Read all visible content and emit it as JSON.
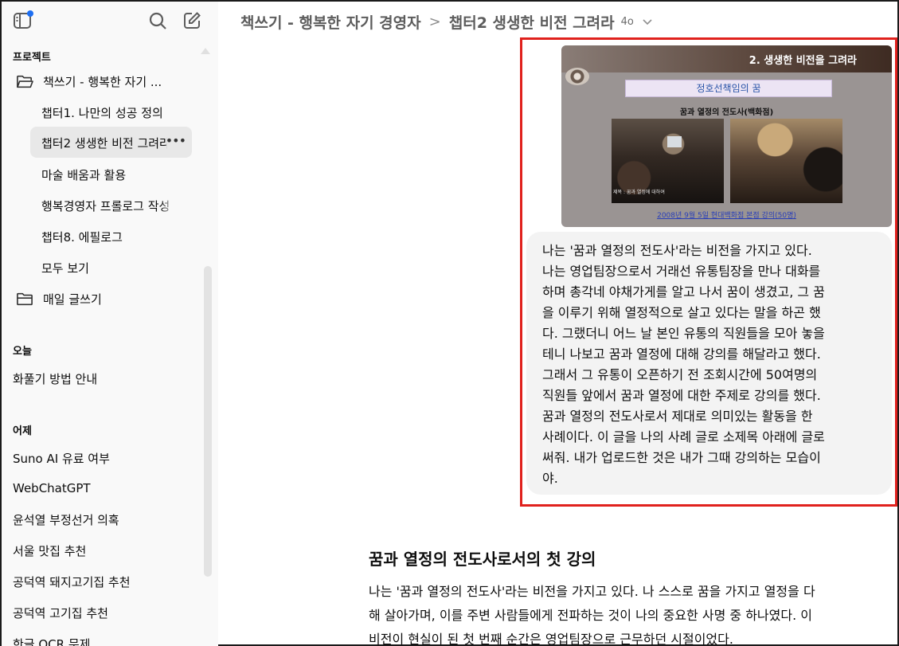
{
  "sidebar": {
    "projects_label": "프로젝트",
    "project_folder": "책쓰기 - 행복한 자기 ...",
    "project_children": [
      "챕터1. 나만의 성공 정의",
      "챕터2 생생한 비전 그려라",
      "마술 배움과 활용",
      "행복경영자 프롤로그 작성",
      "챕터8. 에필로그",
      "모두 보기"
    ],
    "active_more": "•••",
    "daily_folder": "매일 글쓰기",
    "today_label": "오늘",
    "today_items": [
      "화풀기 방법 안내"
    ],
    "yesterday_label": "어제",
    "yesterday_items": [
      "Suno AI 유료 여부",
      "WebChatGPT",
      "윤석열 부정선거 의혹",
      "서울 맛집 추천",
      "공덕역 돼지고기집 추천",
      "공덕역 고기집 추천",
      "한글 OCR 문제"
    ]
  },
  "header": {
    "project": "책쓰기 - 행복한 자기 경영자",
    "separator": ">",
    "chat": "챕터2 생생한 비전 그려라",
    "model": "4o"
  },
  "slide": {
    "title": "2. 생생한 비전을 그려라",
    "pill": "정호선책임의 꿈",
    "subtitle": "꿈과 열정의 전도사(백화점)",
    "photo_caption": "제목 : 꿈과 열정에 대하여",
    "footer": "2008년 9월 5일 현대백화점 본점 강의(50명)"
  },
  "user_message": {
    "lines": [
      "나는 '꿈과 열정의 전도사'라는 비전을 가지고 있다.",
      "나는 영업팀장으로서 거래선 유통팀장을 만나 대화를",
      "하며 총각네 야채가게를 알고 나서 꿈이 생겼고, 그 꿈",
      "을 이루기 위해 열정적으로 살고 있다는 말을 하곤 했",
      "다. 그랬더니 어느 날 본인 유통의 직원들을 모아 놓을",
      "테니 나보고 꿈과 열정에 대해 강의를 해달라고 했다.",
      "그래서 그 유통이 오픈하기 전 조회시간에 50여명의",
      "직원들 앞에서 꿈과 열정에 대한 주제로 강의를 했다.",
      "꿈과 열정의 전도사로서 제대로 의미있는 활동을 한",
      "사례이다. 이 글을 나의 사례 글로 소제목 아래에 글로",
      "써줘. 내가 업로드한 것은 내가 그때 강의하는 모습이",
      "야."
    ]
  },
  "response": {
    "title": "꿈과 열정의 전도사로서의 첫 강의",
    "lines": [
      "나는 '꿈과 열정의 전도사'라는 비전을 가지고 있다. 나 스스로 꿈을 가지고 열정을 다",
      "해 살아가며, 이를 주변 사람들에게 전파하는 것이 나의 중요한 사명 중 하나였다. 이",
      "비전이 현실이 된 첫 번째 순간은 영업팀장으로 근무하던 시절이었다."
    ]
  },
  "colors": {
    "annotation_box": "#e0211d",
    "notification_dot": "#1d6ff2",
    "sidebar_bg": "#f9f9f9",
    "bubble_bg": "#f3f3f3"
  },
  "icons": [
    "sidebar-toggle-icon",
    "search-icon",
    "new-chat-icon",
    "folder-open-icon",
    "folder-icon",
    "chevron-down-icon"
  ]
}
